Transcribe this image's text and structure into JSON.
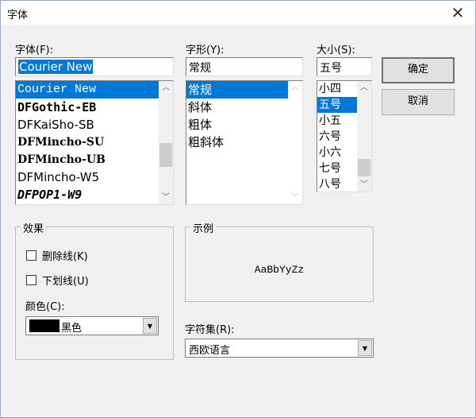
{
  "window": {
    "title": "字体",
    "close_icon": "close-icon"
  },
  "font": {
    "label": "字体(F):",
    "value": "Courier New",
    "items": [
      "Courier New",
      "DFGothic-EB",
      "DFKaiSho-SB",
      "DFMincho-SU",
      "DFMincho-UB",
      "DFMincho-W5",
      "DFPOP1-W9"
    ],
    "selected": "Courier New"
  },
  "style": {
    "label": "字形(Y):",
    "value": "常规",
    "items": [
      "常规",
      "斜体",
      "粗体",
      "粗斜体"
    ],
    "selected": "常规"
  },
  "size": {
    "label": "大小(S):",
    "value": "五号",
    "items": [
      "小四",
      "五号",
      "小五",
      "六号",
      "小六",
      "七号",
      "八号"
    ],
    "selected": "五号"
  },
  "buttons": {
    "ok": "确定",
    "cancel": "取消"
  },
  "effects": {
    "title": "效果",
    "strikeout": "删除线(K)",
    "strikeout_checked": false,
    "underline": "下划线(U)",
    "underline_checked": false,
    "color_label": "颜色(C):",
    "color_value": "黑色",
    "color_swatch": "#000000"
  },
  "sample": {
    "title": "示例",
    "text": "AaBbYyZz"
  },
  "charset": {
    "label": "字符集(R):",
    "value": "西欧语言"
  },
  "colors": {
    "accent": "#0078d7"
  }
}
